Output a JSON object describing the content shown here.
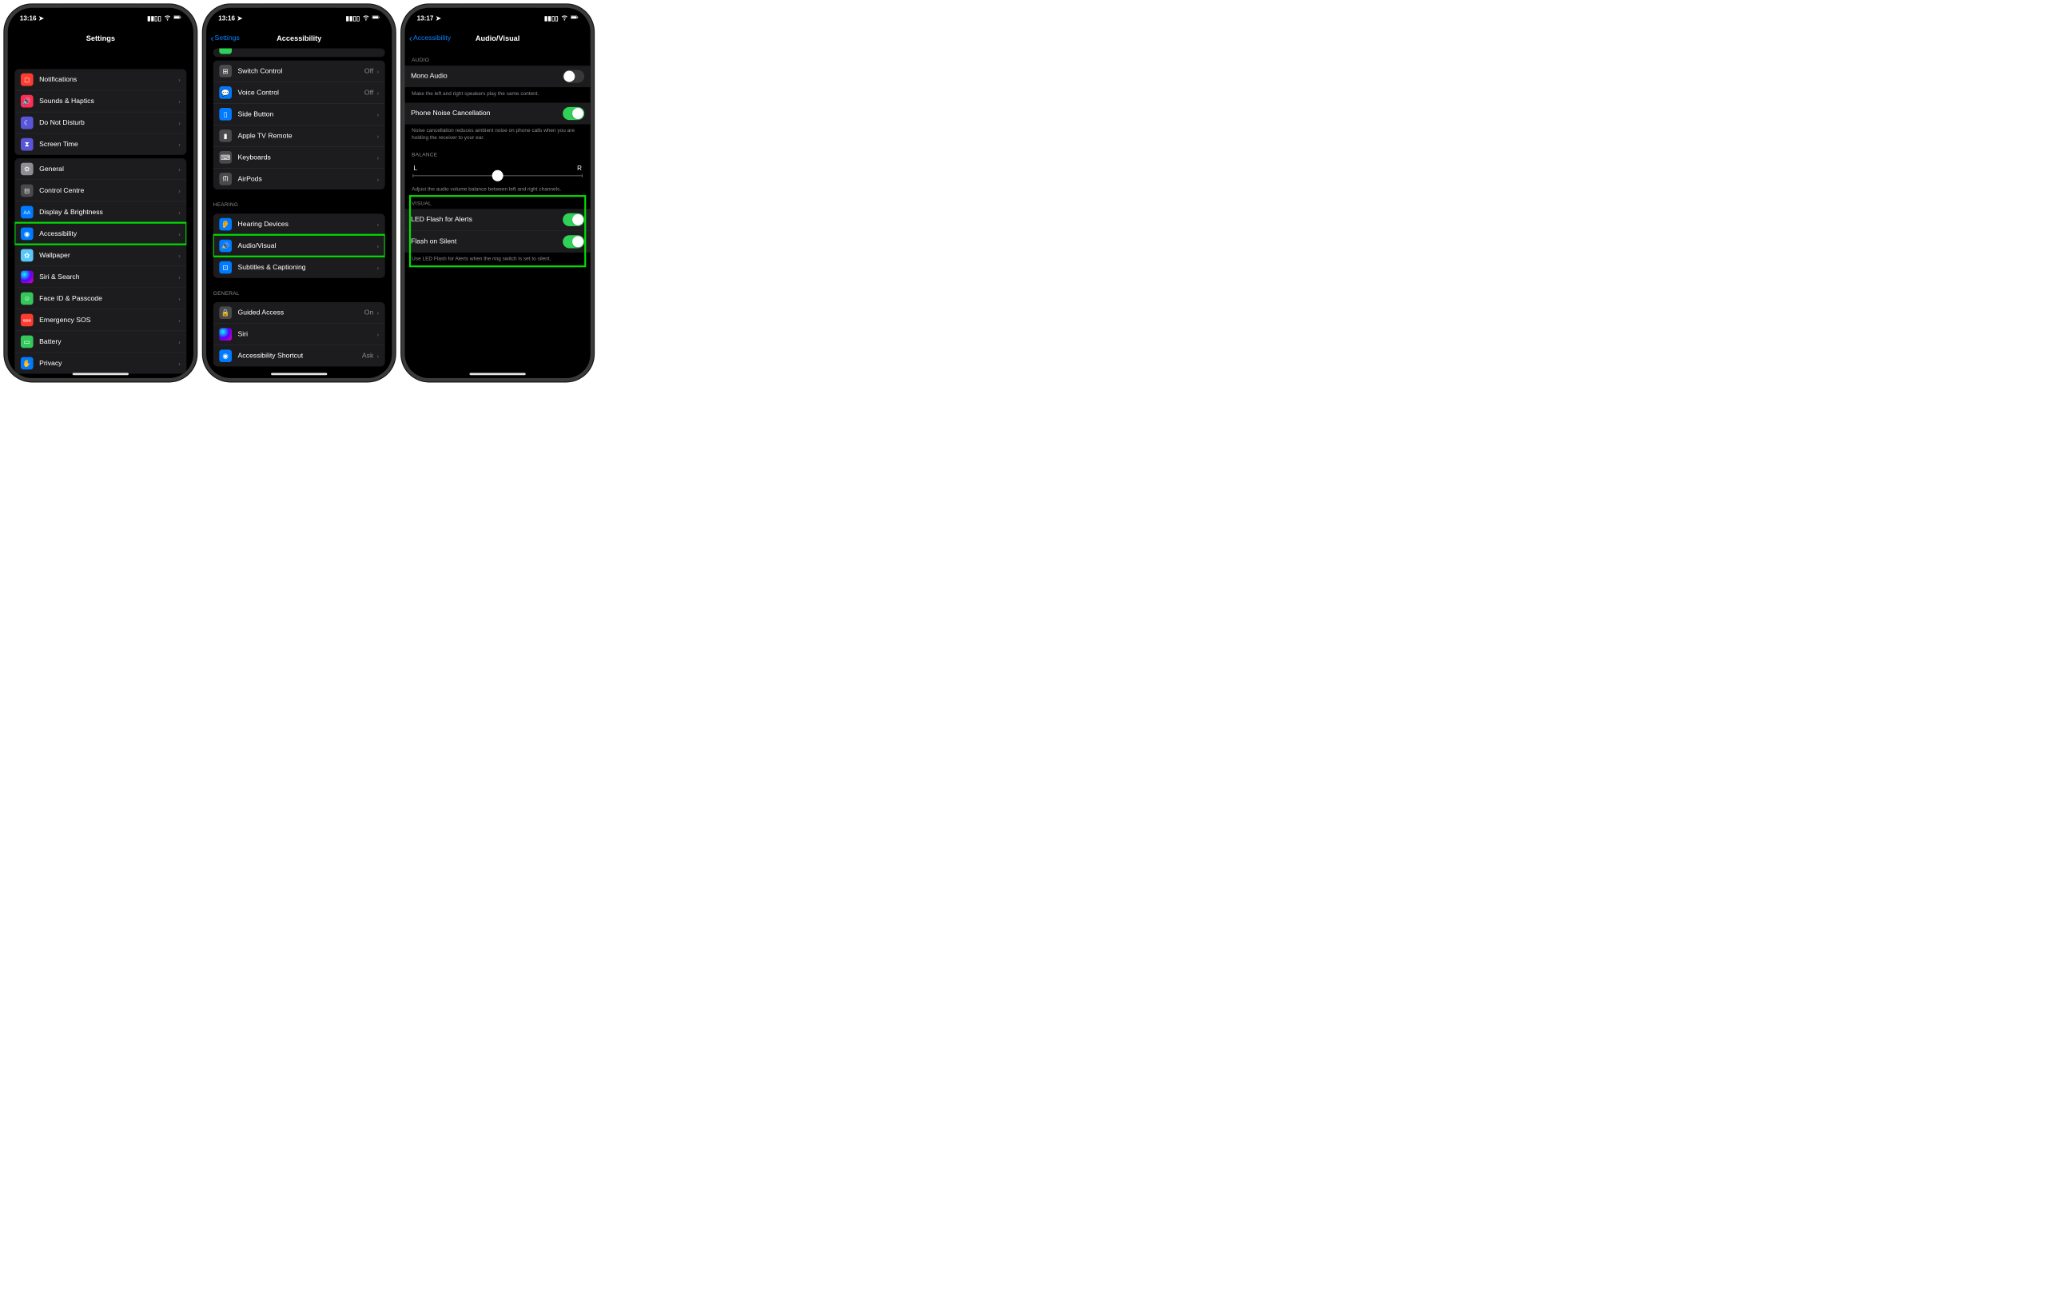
{
  "screen1": {
    "time": "13:16",
    "title": "Settings",
    "groups": [
      {
        "rows": [
          {
            "icon": "bg-red",
            "name": "notifications",
            "label": "Notifications",
            "glyph": "square"
          },
          {
            "icon": "bg-pink",
            "name": "sounds-haptics",
            "label": "Sounds & Haptics",
            "glyph": "speaker"
          },
          {
            "icon": "bg-purple",
            "name": "do-not-disturb",
            "label": "Do Not Disturb",
            "glyph": "moon"
          },
          {
            "icon": "bg-indigo",
            "name": "screen-time",
            "label": "Screen Time",
            "glyph": "hourglass"
          }
        ]
      },
      {
        "rows": [
          {
            "icon": "bg-gray",
            "name": "general",
            "label": "General",
            "glyph": "gear"
          },
          {
            "icon": "bg-darkgray",
            "name": "control-centre",
            "label": "Control Centre",
            "glyph": "switches"
          },
          {
            "icon": "bg-blue",
            "name": "display-brightness",
            "label": "Display & Brightness",
            "glyph": "AA",
            "text": true
          },
          {
            "icon": "bg-blue",
            "name": "accessibility",
            "label": "Accessibility",
            "highlight": true,
            "glyph": "person"
          },
          {
            "icon": "bg-teal",
            "name": "wallpaper",
            "label": "Wallpaper",
            "glyph": "flower"
          },
          {
            "icon": "bg-siri",
            "name": "siri-search",
            "label": "Siri & Search",
            "glyph": ""
          },
          {
            "icon": "bg-green",
            "name": "face-id-passcode",
            "label": "Face ID & Passcode",
            "glyph": "face"
          },
          {
            "icon": "bg-sos",
            "name": "emergency-sos",
            "label": "Emergency SOS",
            "glyph": "SOS",
            "text": true
          },
          {
            "icon": "bg-green",
            "name": "battery",
            "label": "Battery",
            "glyph": "battery"
          },
          {
            "icon": "bg-blue",
            "name": "privacy",
            "label": "Privacy",
            "glyph": "hand"
          }
        ]
      }
    ]
  },
  "screen2": {
    "time": "13:16",
    "back": "Settings",
    "title": "Accessibility",
    "sections": [
      {
        "rows": [
          {
            "icon": "bg-darkgray",
            "name": "switch-control",
            "label": "Switch Control",
            "detail": "Off",
            "glyph": "grid"
          },
          {
            "icon": "bg-blue",
            "name": "voice-control",
            "label": "Voice Control",
            "detail": "Off",
            "glyph": "voice"
          },
          {
            "icon": "bg-blue",
            "name": "side-button",
            "label": "Side Button",
            "glyph": "sidebtn"
          },
          {
            "icon": "bg-darkgray",
            "name": "apple-tv-remote",
            "label": "Apple TV Remote",
            "glyph": "remote"
          },
          {
            "icon": "bg-darkgray",
            "name": "keyboards",
            "label": "Keyboards",
            "glyph": "keyboard"
          },
          {
            "icon": "bg-darkgray",
            "name": "airpods",
            "label": "AirPods",
            "glyph": "airpods"
          }
        ]
      },
      {
        "header": "HEARING",
        "rows": [
          {
            "icon": "bg-blue",
            "name": "hearing-devices",
            "label": "Hearing Devices",
            "glyph": "ear"
          },
          {
            "icon": "bg-blue",
            "name": "audio-visual",
            "label": "Audio/Visual",
            "highlight": true,
            "glyph": "audiovisual"
          },
          {
            "icon": "bg-blue",
            "name": "subtitles-captioning",
            "label": "Subtitles & Captioning",
            "glyph": "subtitles"
          }
        ]
      },
      {
        "header": "GENERAL",
        "rows": [
          {
            "icon": "bg-darkgray",
            "name": "guided-access",
            "label": "Guided Access",
            "detail": "On",
            "glyph": "lock"
          },
          {
            "icon": "bg-siri",
            "name": "siri",
            "label": "Siri",
            "glyph": ""
          },
          {
            "icon": "bg-blue",
            "name": "accessibility-shortcut",
            "label": "Accessibility Shortcut",
            "detail": "Ask",
            "glyph": "person"
          }
        ]
      }
    ]
  },
  "screen3": {
    "time": "13:17",
    "back": "Accessibility",
    "title": "Audio/Visual",
    "audio_header": "AUDIO",
    "mono_label": "Mono Audio",
    "mono_footer": "Make the left and right speakers play the same content.",
    "noise_label": "Phone Noise Cancellation",
    "noise_footer": "Noise cancellation reduces ambient noise on phone calls when you are holding the receiver to your ear.",
    "balance_header": "BALANCE",
    "balance_left": "L",
    "balance_right": "R",
    "balance_footer": "Adjust the audio volume balance between left and right channels.",
    "visual_header": "VISUAL",
    "led_label": "LED Flash for Alerts",
    "silent_label": "Flash on Silent",
    "visual_footer": "Use LED Flash for Alerts when the ring switch is set to silent."
  }
}
